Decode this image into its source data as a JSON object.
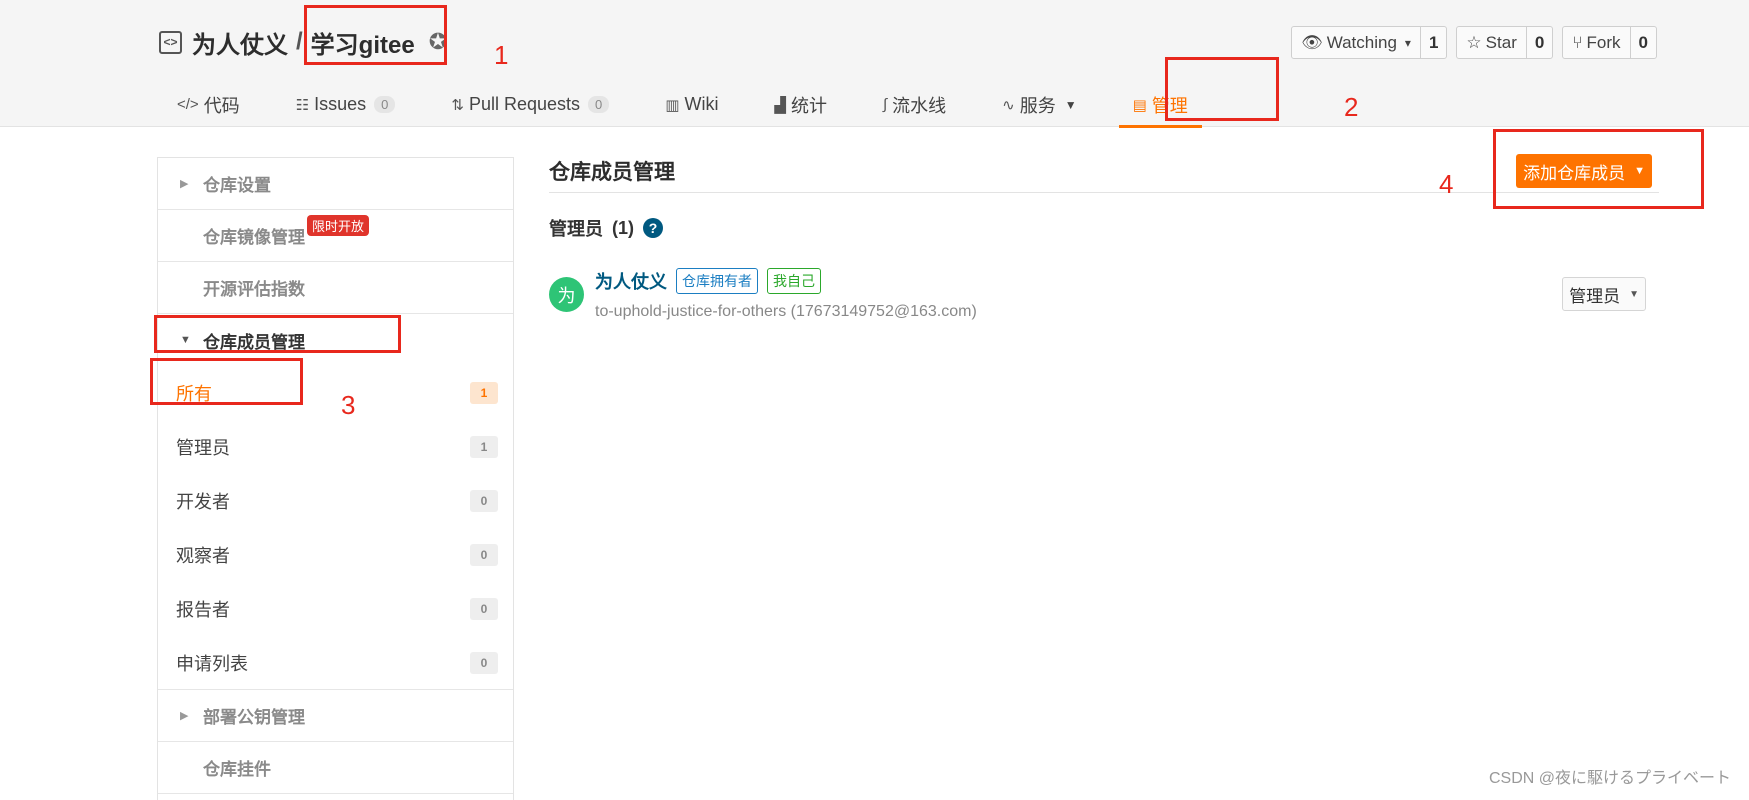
{
  "repo": {
    "owner": "为人仗义",
    "separator": "/",
    "name": "学习gitee",
    "icon": "code-box-icon",
    "badge_icon": "award-badge-icon"
  },
  "actions": [
    {
      "label": "Watching",
      "count": "1",
      "icon": "eye-icon",
      "has_caret": true
    },
    {
      "label": "Star",
      "count": "0",
      "icon": "star-icon"
    },
    {
      "label": "Fork",
      "count": "0",
      "icon": "fork-icon"
    }
  ],
  "tabs": [
    {
      "label": "代码",
      "icon": "code-icon"
    },
    {
      "label": "Issues",
      "count": "0",
      "icon": "issues-icon"
    },
    {
      "label": "Pull Requests",
      "count": "0",
      "icon": "pull-request-icon"
    },
    {
      "label": "Wiki",
      "icon": "book-icon"
    },
    {
      "label": "统计",
      "icon": "bar-chart-icon"
    },
    {
      "label": "流水线",
      "icon": "pipeline-icon"
    },
    {
      "label": "服务",
      "icon": "pulse-icon",
      "has_caret": true
    },
    {
      "label": "管理",
      "icon": "manage-doc-icon",
      "active": true
    }
  ],
  "sidebar": {
    "sections_top": [
      {
        "label": "仓库设置",
        "collapsible": true
      },
      {
        "label": "仓库镜像管理",
        "badge": "限时开放"
      },
      {
        "label": "开源评估指数"
      }
    ],
    "open_section": {
      "label": "仓库成员管理"
    },
    "member_items": [
      {
        "label": "所有",
        "count": "1",
        "active": true
      },
      {
        "label": "管理员",
        "count": "1"
      },
      {
        "label": "开发者",
        "count": "0"
      },
      {
        "label": "观察者",
        "count": "0"
      },
      {
        "label": "报告者",
        "count": "0"
      },
      {
        "label": "申请列表",
        "count": "0"
      }
    ],
    "sections_bottom": [
      {
        "label": "部署公钥管理",
        "collapsible": true
      },
      {
        "label": "仓库挂件"
      }
    ]
  },
  "main": {
    "title": "仓库成员管理",
    "add_button": "添加仓库成员",
    "group_label": "管理员",
    "group_count": "(1)",
    "help_icon": "question-circle-icon",
    "member": {
      "avatar_text": "为",
      "name": "为人仗义",
      "tags": [
        "仓库拥有者",
        "我自己"
      ],
      "email": "to-uphold-justice-for-others (17673149752@163.com)",
      "role": "管理员"
    }
  },
  "annotations": [
    "1",
    "2",
    "3",
    "4"
  ],
  "colors": {
    "accent": "#fe7300",
    "link": "#005980",
    "annotation": "#e8281d",
    "avatar": "#2ec476"
  },
  "watermark": "CSDN @夜に駆けるプライベート"
}
